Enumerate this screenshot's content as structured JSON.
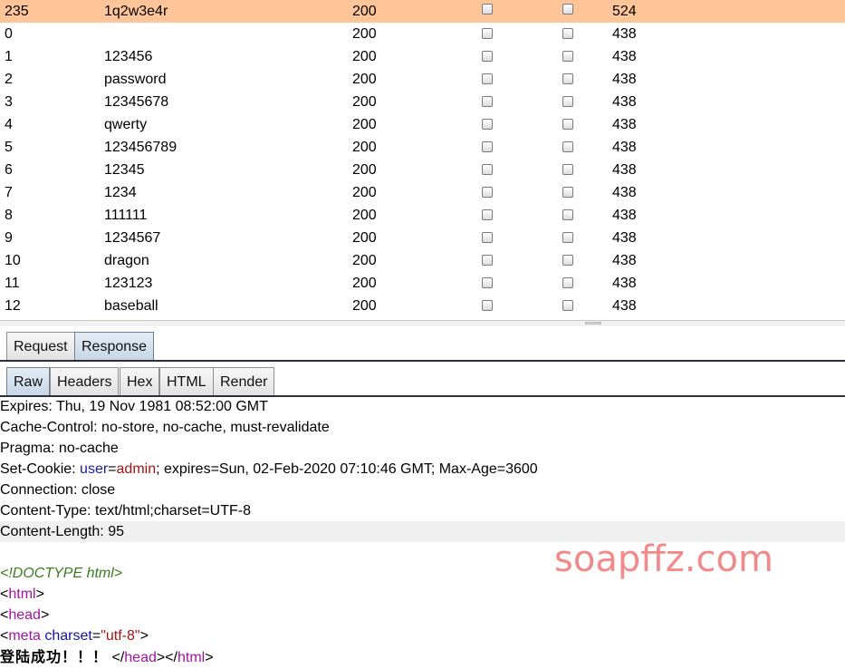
{
  "results": {
    "rows": [
      {
        "num": "235",
        "payload": "1q2w3e4r",
        "status": "200",
        "length": "524",
        "selected": true
      },
      {
        "num": "0",
        "payload": "",
        "status": "200",
        "length": "438"
      },
      {
        "num": "1",
        "payload": "123456",
        "status": "200",
        "length": "438"
      },
      {
        "num": "2",
        "payload": "password",
        "status": "200",
        "length": "438"
      },
      {
        "num": "3",
        "payload": "12345678",
        "status": "200",
        "length": "438"
      },
      {
        "num": "4",
        "payload": "qwerty",
        "status": "200",
        "length": "438"
      },
      {
        "num": "5",
        "payload": "123456789",
        "status": "200",
        "length": "438"
      },
      {
        "num": "6",
        "payload": "12345",
        "status": "200",
        "length": "438"
      },
      {
        "num": "7",
        "payload": "1234",
        "status": "200",
        "length": "438"
      },
      {
        "num": "8",
        "payload": "111111",
        "status": "200",
        "length": "438"
      },
      {
        "num": "9",
        "payload": "1234567",
        "status": "200",
        "length": "438"
      },
      {
        "num": "10",
        "payload": "dragon",
        "status": "200",
        "length": "438"
      },
      {
        "num": "11",
        "payload": "123123",
        "status": "200",
        "length": "438"
      },
      {
        "num": "12",
        "payload": "baseball",
        "status": "200",
        "length": "438"
      }
    ]
  },
  "tabs_main": [
    {
      "label": "Request",
      "active": false
    },
    {
      "label": "Response",
      "active": true
    }
  ],
  "tabs_view": [
    {
      "label": "Raw",
      "active": true
    },
    {
      "label": "Headers",
      "active": false
    },
    {
      "label": "Hex",
      "active": false
    },
    {
      "label": "HTML",
      "active": false
    },
    {
      "label": "Render",
      "active": false
    }
  ],
  "response": {
    "expires": "Expires: Thu, 19 Nov 1981 08:52:00 GMT",
    "cache_control": "Cache-Control: no-store, no-cache, must-revalidate",
    "pragma": "Pragma: no-cache",
    "set_cookie_prefix": "Set-Cookie: ",
    "cookie_name": "user",
    "cookie_eq": "=",
    "cookie_value": "admin",
    "set_cookie_rest": "; expires=Sun, 02-Feb-2020 07:10:46 GMT; Max-Age=3600",
    "connection": "Connection: close",
    "content_type": "Content-Type: text/html;charset=UTF-8",
    "content_length": "Content-Length: 95",
    "doctype": "<!DOCTYPE html>",
    "tag_html": "html",
    "tag_head": "head",
    "tag_meta": "meta",
    "attr_charset": "charset",
    "charset_value": "\"utf-8\"",
    "body_text": "登陆成功！！！",
    "lt": "<",
    "gt": ">",
    "lt_slash": "</",
    "eq": "="
  },
  "watermark": "soapffz.com",
  "colors": {
    "selected_row": "#ffc599",
    "active_tab": "#c7d6e6",
    "watermark": "#f28a8a"
  }
}
